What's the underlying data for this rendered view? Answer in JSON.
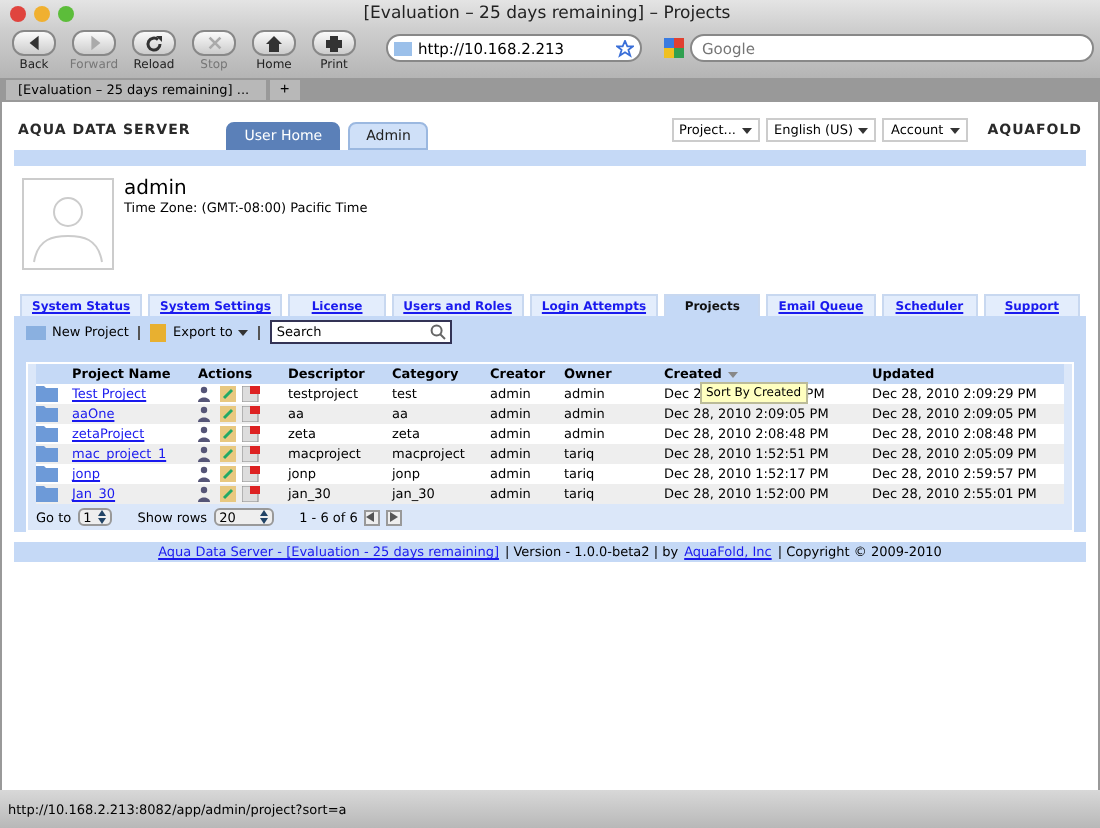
{
  "browser": {
    "title": "[Evaluation – 25 days remaining] – Projects",
    "buttons": [
      {
        "label": "Back",
        "kind": "back",
        "disabled": false
      },
      {
        "label": "Forward",
        "kind": "forward",
        "disabled": true
      },
      {
        "label": "Reload",
        "kind": "reload",
        "disabled": false
      },
      {
        "label": "Stop",
        "kind": "stop",
        "disabled": true
      },
      {
        "label": "Home",
        "kind": "home",
        "disabled": false
      },
      {
        "label": "Print",
        "kind": "print",
        "disabled": false
      }
    ],
    "url": "http://10.168.2.213",
    "search_placeholder": "Google",
    "tab": "[Evaluation – 25 days remaining] ...",
    "new_tab": "+",
    "status": "http://10.168.2.213:8082/app/admin/project?sort=a"
  },
  "header": {
    "logo_left": "AQUA DATA SERVER",
    "logo_right": "AQUAFOLD",
    "tabs": [
      {
        "label": "User Home",
        "selected": false
      },
      {
        "label": "Admin",
        "selected": true
      }
    ],
    "menus": [
      "Project...",
      "English (US)",
      "Account"
    ]
  },
  "profile": {
    "name": "admin",
    "timezone": "Time Zone: (GMT:-08:00) Pacific Time"
  },
  "nav_tabs": [
    {
      "label": "System Status",
      "selected": false
    },
    {
      "label": "System Settings",
      "selected": false
    },
    {
      "label": "License",
      "selected": false
    },
    {
      "label": "Users and Roles",
      "selected": false
    },
    {
      "label": "Login Attempts",
      "selected": false
    },
    {
      "label": "Projects",
      "selected": true
    },
    {
      "label": "Email Queue",
      "selected": false
    },
    {
      "label": "Scheduler",
      "selected": false
    },
    {
      "label": "Support",
      "selected": false
    }
  ],
  "toolbar": {
    "new_project": "New Project",
    "export": "Export to",
    "search_value": "Search"
  },
  "table": {
    "columns": [
      "Project Name",
      "Actions",
      "Descriptor",
      "Category",
      "Creator",
      "Owner",
      "Created",
      "Updated"
    ],
    "rows": [
      {
        "name": "Test Project",
        "descriptor": "testproject",
        "category": "test",
        "creator": "admin",
        "owner": "admin",
        "created": "Dec 2",
        "created_after": "PM",
        "updated": "Dec 28, 2010 2:09:29 PM"
      },
      {
        "name": "aaOne",
        "descriptor": "aa",
        "category": "aa",
        "creator": "admin",
        "owner": "admin",
        "created": "Dec 28, 2010 2:09:05 PM",
        "updated": "Dec 28, 2010 2:09:05 PM"
      },
      {
        "name": "zetaProject",
        "descriptor": "zeta",
        "category": "zeta",
        "creator": "admin",
        "owner": "admin",
        "created": "Dec 28, 2010 2:08:48 PM",
        "updated": "Dec 28, 2010 2:08:48 PM"
      },
      {
        "name": "mac_project_1",
        "descriptor": "macproject",
        "category": "macproject",
        "creator": "admin",
        "owner": "tariq",
        "created": "Dec 28, 2010 1:52:51 PM",
        "updated": "Dec 28, 2010 2:05:09 PM"
      },
      {
        "name": "jonp",
        "descriptor": "jonp",
        "category": "jonp",
        "creator": "admin",
        "owner": "tariq",
        "created": "Dec 28, 2010 1:52:17 PM",
        "updated": "Dec 28, 2010 2:59:57 PM"
      },
      {
        "name": "Jan_30",
        "descriptor": "jan_30",
        "category": "jan_30",
        "creator": "admin",
        "owner": "tariq",
        "created": "Dec 28, 2010 1:52:00 PM",
        "updated": "Dec 28, 2010 2:55:01 PM"
      }
    ],
    "tooltip": "Sort By Created",
    "goto_label": "Go to",
    "goto_value": "1",
    "rows_label": "Show rows",
    "rows_value": "20",
    "range": "1 - 6 of 6"
  },
  "footer": {
    "link1": "Aqua Data Server - [Evaluation - 25 days remaining]",
    "text1": "| Version - 1.0.0-beta2 | by",
    "link2": "AquaFold, Inc",
    "text2": "| Copyright © 2009-2010"
  }
}
